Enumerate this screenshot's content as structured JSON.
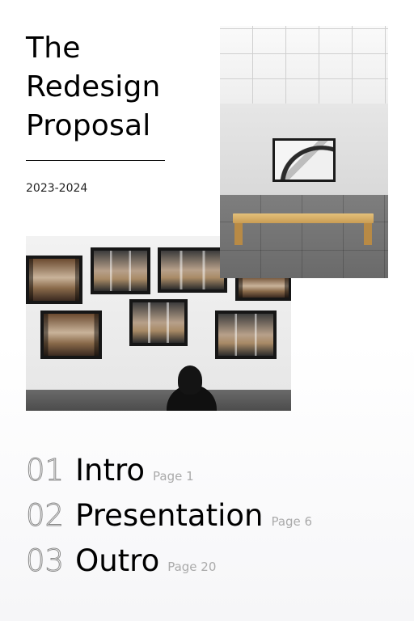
{
  "cover": {
    "title_line1": "The",
    "title_line2": "Redesign",
    "title_line3": "Proposal",
    "years": "2023-2024"
  },
  "toc": [
    {
      "num": "01",
      "label": "Intro",
      "page": "Page 1"
    },
    {
      "num": "02",
      "label": "Presentation",
      "page": "Page 6"
    },
    {
      "num": "03",
      "label": "Outro",
      "page": "Page 20"
    }
  ]
}
